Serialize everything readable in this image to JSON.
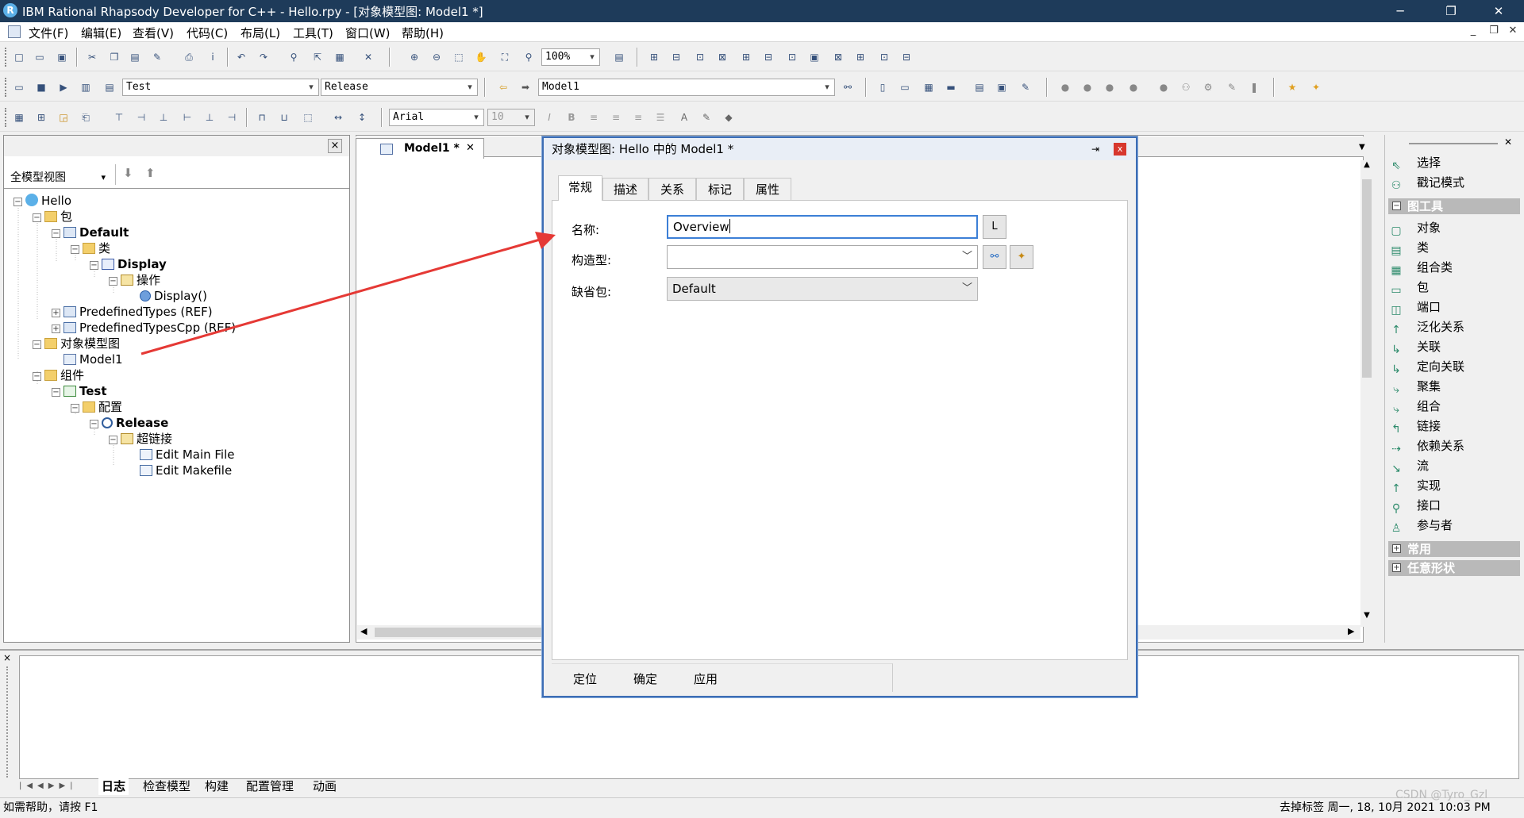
{
  "titlebar": {
    "title": "IBM Rational Rhapsody Developer for C++ - Hello.rpy - [对象模型图: Model1 *]",
    "minimize": "─",
    "restore": "❐",
    "close": "✕"
  },
  "menu": {
    "items": [
      "文件(F)",
      "编辑(E)",
      "查看(V)",
      "代码(C)",
      "布局(L)",
      "工具(T)",
      "窗口(W)",
      "帮助(H)"
    ],
    "mdi_minimize": "_",
    "mdi_restore": "❐",
    "mdi_close": "✕"
  },
  "toolbar1": {
    "zoom": "100%"
  },
  "toolbar2": {
    "component_combo": "Test",
    "config_combo": "Release",
    "diagram_combo": "Model1"
  },
  "toolbar3": {
    "font_combo": "Arial",
    "font_size": "10"
  },
  "browser": {
    "view_mode": "全模型视图",
    "close": "×",
    "tree": [
      {
        "label": "Hello",
        "depth": 0,
        "exp": "−",
        "icon": "hello",
        "bold": false
      },
      {
        "label": "包",
        "depth": 1,
        "exp": "−",
        "icon": "folder",
        "bold": false
      },
      {
        "label": "Default",
        "depth": 2,
        "exp": "−",
        "icon": "pkg",
        "bold": true
      },
      {
        "label": "类",
        "depth": 3,
        "exp": "−",
        "icon": "folder",
        "bold": false
      },
      {
        "label": "Display",
        "depth": 4,
        "exp": "−",
        "icon": "cls",
        "bold": true
      },
      {
        "label": "操作",
        "depth": 5,
        "exp": "−",
        "icon": "op",
        "bold": false
      },
      {
        "label": "Display()",
        "depth": 6,
        "exp": "",
        "icon": "meth",
        "bold": false
      },
      {
        "label": "PredefinedTypes (REF)",
        "depth": 2,
        "exp": "+",
        "icon": "pkg",
        "bold": false
      },
      {
        "label": "PredefinedTypesCpp (REF)",
        "depth": 2,
        "exp": "+",
        "icon": "pkg",
        "bold": false
      },
      {
        "label": "对象模型图",
        "depth": 1,
        "exp": "−",
        "icon": "folder",
        "bold": false
      },
      {
        "label": "Model1",
        "depth": 2,
        "exp": "",
        "icon": "diag",
        "bold": false
      },
      {
        "label": "组件",
        "depth": 1,
        "exp": "−",
        "icon": "folder",
        "bold": false
      },
      {
        "label": "Test",
        "depth": 2,
        "exp": "−",
        "icon": "comp",
        "bold": true
      },
      {
        "label": "配置",
        "depth": 3,
        "exp": "−",
        "icon": "folder",
        "bold": false
      },
      {
        "label": "Release",
        "depth": 4,
        "exp": "−",
        "icon": "cfg",
        "bold": true
      },
      {
        "label": "超链接",
        "depth": 5,
        "exp": "−",
        "icon": "op",
        "bold": false
      },
      {
        "label": "Edit Main File",
        "depth": 6,
        "exp": "",
        "icon": "file",
        "bold": false
      },
      {
        "label": "Edit Makefile",
        "depth": 6,
        "exp": "",
        "icon": "file",
        "bold": false
      }
    ]
  },
  "editor": {
    "tab_label": "Model1 *",
    "tab_close": "✕"
  },
  "dialog": {
    "title": "对象模型图: Hello 中的 Model1 *",
    "pin": "⇥",
    "close": "x",
    "tabs": [
      "常规",
      "描述",
      "关系",
      "标记",
      "属性"
    ],
    "name_label": "名称:",
    "name_value": "Overview",
    "l_button": "L",
    "stereotype_label": "构造型:",
    "stereotype_value": "",
    "default_package_label": "缺省包:",
    "default_package_value": "Default",
    "buttons": [
      "定位",
      "确定",
      "应用"
    ]
  },
  "palette": {
    "close": "✕",
    "items_top": [
      "选择",
      "戳记模式"
    ],
    "group_diagram": "图工具",
    "diagram_tools": [
      "对象",
      "类",
      "组合类",
      "包",
      "端口",
      "泛化关系",
      "关联",
      "定向关联",
      "聚集",
      "组合",
      "链接",
      "依赖关系",
      "流",
      "实现",
      "接口",
      "参与者"
    ],
    "group_common": "常用",
    "group_free": "任意形状"
  },
  "output": {
    "tabs": [
      "日志",
      "检查模型",
      "构建",
      "配置管理",
      "动画"
    ],
    "close": "×"
  },
  "status": {
    "help": "如需帮助，请按 F1",
    "right": "去掉标签  周一, 18, 10月 2021  10:03  PM",
    "watermark": "CSDN @Tyro_Gzl"
  },
  "colors": {
    "titlebar": "#1e3b5a",
    "annotation_arrow": "#e53935",
    "focus_border": "#3c7fd6"
  }
}
